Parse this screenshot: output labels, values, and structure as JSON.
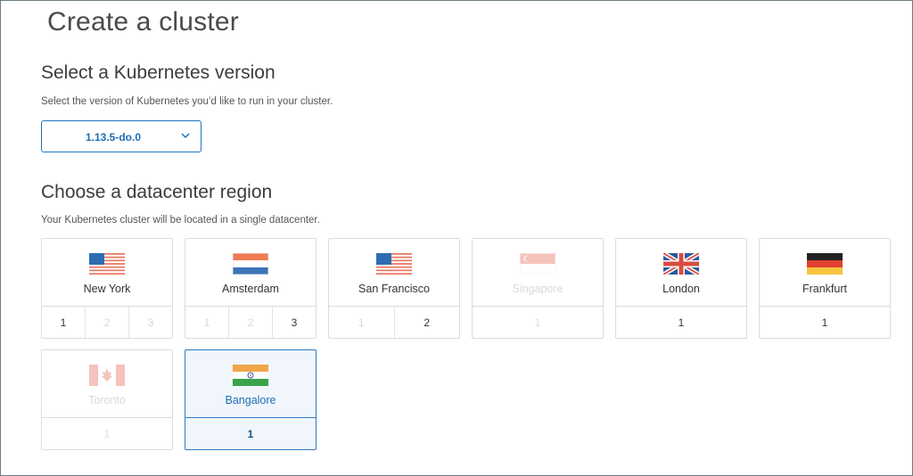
{
  "page": {
    "title": "Create a cluster"
  },
  "version_section": {
    "heading": "Select a Kubernetes version",
    "description": "Select the version of Kubernetes you’d like to run in your cluster.",
    "selected_version": "1.13.5-do.0"
  },
  "region_section": {
    "heading": "Choose a datacenter region",
    "description": "Your Kubernetes cluster will be located in a single datacenter.",
    "regions": [
      {
        "name": "New York",
        "flag": "us-flag-icon",
        "datacenters": [
          "1",
          "2",
          "3"
        ],
        "enabled": [
          true,
          false,
          false
        ],
        "available": true,
        "selected": false
      },
      {
        "name": "Amsterdam",
        "flag": "netherlands-flag-icon",
        "datacenters": [
          "1",
          "2",
          "3"
        ],
        "enabled": [
          false,
          false,
          true
        ],
        "available": true,
        "selected": false
      },
      {
        "name": "San Francisco",
        "flag": "us-flag-icon",
        "datacenters": [
          "1",
          "2"
        ],
        "enabled": [
          false,
          true
        ],
        "available": true,
        "selected": false
      },
      {
        "name": "Singapore",
        "flag": "singapore-flag-icon",
        "datacenters": [
          "1"
        ],
        "enabled": [
          false
        ],
        "available": false,
        "selected": false
      },
      {
        "name": "London",
        "flag": "uk-flag-icon",
        "datacenters": [
          "1"
        ],
        "enabled": [
          true
        ],
        "available": true,
        "selected": false
      },
      {
        "name": "Frankfurt",
        "flag": "germany-flag-icon",
        "datacenters": [
          "1"
        ],
        "enabled": [
          true
        ],
        "available": true,
        "selected": false
      },
      {
        "name": "Toronto",
        "flag": "canada-flag-icon",
        "datacenters": [
          "1"
        ],
        "enabled": [
          false
        ],
        "available": false,
        "selected": false
      },
      {
        "name": "Bangalore",
        "flag": "india-flag-icon",
        "datacenters": [
          "1"
        ],
        "enabled": [
          true
        ],
        "available": true,
        "selected": true
      }
    ]
  },
  "colors": {
    "accent": "#1d6fb3",
    "selected_bg": "#f1f6fc",
    "border": "#dcdcdc"
  }
}
